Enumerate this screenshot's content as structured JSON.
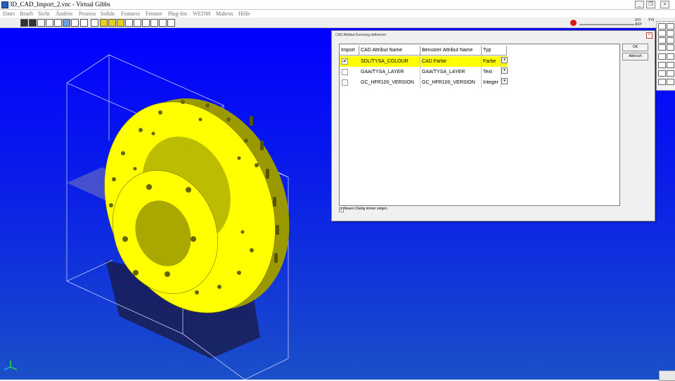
{
  "window": {
    "title": "3D_CAD_Import_2.vnc - Virtual Gibbs",
    "minimize_glyph": "_",
    "restore_glyph": "❐",
    "close_glyph": "×"
  },
  "menubar": {
    "items": [
      "Datei",
      "Bearb",
      "Sicht",
      "Ändern",
      "Prozess",
      "Solids",
      "Features",
      "Fenster",
      "Plug-Ins",
      "WEDM",
      "Makros",
      "Hilfe"
    ]
  },
  "toolbar": {
    "value_top": "XYI",
    "value_bottom": "ASY",
    "value_right": "YYI",
    "accent_stop": "#e01818"
  },
  "viewport": {
    "background_top": "#0000ff",
    "part_color": "#ffff00"
  },
  "dialog": {
    "title": "CAD Attribut Kennung definieren",
    "close_glyph": "×",
    "columns": [
      "Import",
      "CAD Attribut Name",
      "Benutzer Attribut Name",
      "Typ"
    ],
    "rows": [
      {
        "checked": "✔",
        "cad_name": "SDL/TYSA_COLOUR",
        "user_name": "CAD Farbe",
        "type": "Farbe"
      },
      {
        "checked": "",
        "cad_name": "GAA/TYSA_LAYER",
        "user_name": "GAA/TYSA_LAYER",
        "type": "Text"
      },
      {
        "checked": "",
        "cad_name": "GC_HFR100_VERSION",
        "user_name": "GC_HFR100_VERSION",
        "type": "Integer"
      }
    ],
    "dropdown_glyph": "▾",
    "ok_label": "OK",
    "cancel_label": "Abbruch",
    "footer_check": "✔",
    "footer_label": "Neuen Dialog immer zeigen"
  }
}
